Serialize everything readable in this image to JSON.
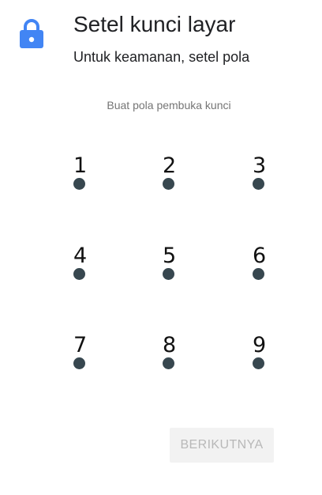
{
  "header": {
    "icon": "lock-icon",
    "title": "Setel kunci layar",
    "subtitle": "Untuk keamanan, setel pola"
  },
  "pattern": {
    "hint": "Buat pola pembuka kunci",
    "nodes": [
      "1",
      "2",
      "3",
      "4",
      "5",
      "6",
      "7",
      "8",
      "9"
    ]
  },
  "footer": {
    "next_label": "BERIKUTNYA"
  },
  "colors": {
    "accent": "#4285f4",
    "dot": "#37474f",
    "button_bg": "#f2f2f2",
    "button_text_disabled": "#b8b8b8"
  }
}
